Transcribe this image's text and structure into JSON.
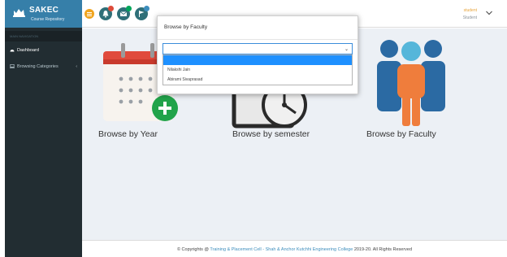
{
  "brand": {
    "name": "SAKEC",
    "subtitle": "Course Repository"
  },
  "sidebar": {
    "header": "MAIN NAVIGATION",
    "items": [
      {
        "label": "Dashboard"
      },
      {
        "label": "Browsing Categories"
      }
    ]
  },
  "header": {
    "user_name": "student",
    "user_role": "Student"
  },
  "cards": [
    {
      "label": "Browse by Year"
    },
    {
      "label": "Browse by semester"
    },
    {
      "label": "Browse by Faculty"
    }
  ],
  "dropdown": {
    "title": "Browse by Faculty",
    "selected": "",
    "options": [
      "",
      "Nilakshi Jain",
      "Abirami Sivaprasad"
    ]
  },
  "footer": {
    "prefix": "© Copyrights @",
    "link": "Training & Placement Cell - Shah & Anchor Kutchhi Engineering College",
    "suffix": "2019-20. All Rights Reserved"
  },
  "colors": {
    "sidebar_bg": "#222d32",
    "brand_bg": "#367fa9",
    "accent": "#3c8dbc",
    "highlight": "#1e90ff",
    "user_name": "#e8a33a"
  },
  "icons": {
    "brand": "chart-icon",
    "dashboard": "dashboard-icon",
    "categories": "laptop-icon",
    "menu": "hamburger-icon"
  }
}
